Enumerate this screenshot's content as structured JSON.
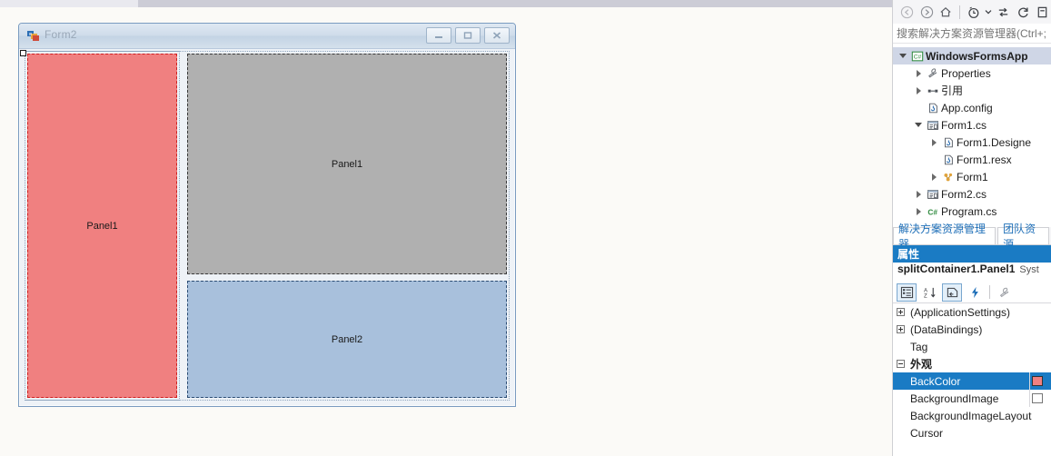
{
  "designer": {
    "form": {
      "title": "Form2",
      "icon": "windows-form-icon",
      "window_buttons": [
        {
          "name": "minimize-button",
          "glyph": "minimize-icon"
        },
        {
          "name": "maximize-button",
          "glyph": "maximize-icon"
        },
        {
          "name": "close-button",
          "glyph": "close-icon"
        }
      ],
      "panels": [
        {
          "name": "panel-left",
          "label": "Panel1",
          "color": "#f08080",
          "border_color": "#d11f1f"
        },
        {
          "name": "panel-top-right",
          "label": "Panel1",
          "color": "#b0b0b0",
          "border_color": "#3a3a3a"
        },
        {
          "name": "panel-bottom-right",
          "label": "Panel2",
          "color": "#a8c0dc",
          "border_color": "#2b4c73"
        }
      ]
    }
  },
  "solution_explorer": {
    "toolbar": [
      {
        "name": "back-button",
        "icon": "back-arrow-icon"
      },
      {
        "name": "forward-button",
        "icon": "forward-arrow-icon"
      },
      {
        "name": "home-button",
        "icon": "home-icon"
      },
      {
        "name": "pending-changes-button",
        "icon": "clock-icon"
      },
      {
        "name": "pending-changes-dropdown",
        "icon": "chevron-down-icon"
      },
      {
        "name": "sync-button",
        "icon": "sync-arrows-icon"
      },
      {
        "name": "refresh-button",
        "icon": "refresh-icon"
      },
      {
        "name": "collapse-all-button",
        "icon": "collapse-all-icon"
      }
    ],
    "search": {
      "placeholder": "搜索解决方案资源管理器(Ctrl+;",
      "value": ""
    },
    "tree": [
      {
        "label": "WindowsFormsApp",
        "icon": "csharp-project-icon",
        "indent": 0,
        "expander": "expanded",
        "bold": true,
        "selected": true
      },
      {
        "label": "Properties",
        "icon": "wrench-icon",
        "indent": 1,
        "expander": "collapsed",
        "bold": false,
        "selected": false
      },
      {
        "label": "引用",
        "icon": "references-icon",
        "indent": 1,
        "expander": "collapsed",
        "bold": false,
        "selected": false
      },
      {
        "label": "App.config",
        "icon": "config-file-icon",
        "indent": 1,
        "expander": "none",
        "bold": false,
        "selected": false
      },
      {
        "label": "Form1.cs",
        "icon": "form-file-icon",
        "indent": 1,
        "expander": "expanded",
        "bold": false,
        "selected": false
      },
      {
        "label": "Form1.Designe",
        "icon": "code-file-icon",
        "indent": 2,
        "expander": "collapsed",
        "bold": false,
        "selected": false
      },
      {
        "label": "Form1.resx",
        "icon": "code-file-icon",
        "indent": 2,
        "expander": "none",
        "bold": false,
        "selected": false
      },
      {
        "label": "Form1",
        "icon": "class-icon",
        "indent": 2,
        "expander": "collapsed",
        "bold": false,
        "selected": false
      },
      {
        "label": "Form2.cs",
        "icon": "form-file-icon",
        "indent": 1,
        "expander": "collapsed",
        "bold": false,
        "selected": false
      },
      {
        "label": "Program.cs",
        "icon": "csharp-file-icon",
        "indent": 1,
        "expander": "collapsed",
        "bold": false,
        "selected": false
      }
    ],
    "tabs": [
      {
        "label": "解决方案资源管理器",
        "active": true
      },
      {
        "label": "团队资源",
        "active": false
      }
    ]
  },
  "properties": {
    "header": "属性",
    "object_name": "splitContainer1.Panel1",
    "object_type": "Syst",
    "toolbar": [
      {
        "name": "categorized-button",
        "icon": "categorized-icon",
        "active": true
      },
      {
        "name": "alphabetical-button",
        "icon": "sort-az-icon",
        "active": false
      },
      {
        "name": "properties-button",
        "icon": "properties-page-icon",
        "active": true
      },
      {
        "name": "events-button",
        "icon": "lightning-bolt-icon",
        "active": false
      },
      {
        "name": "property-pages-button",
        "icon": "wrench-icon",
        "active": false
      }
    ],
    "rows": [
      {
        "name": "(ApplicationSettings)",
        "expander": "plus",
        "category": false,
        "selected": false,
        "value_kind": "none"
      },
      {
        "name": "(DataBindings)",
        "expander": "plus",
        "category": false,
        "selected": false,
        "value_kind": "none"
      },
      {
        "name": "Tag",
        "expander": "none",
        "category": false,
        "selected": false,
        "value_kind": "none"
      },
      {
        "name": "外观",
        "expander": "minus",
        "category": true,
        "selected": false,
        "value_kind": "none"
      },
      {
        "name": "BackColor",
        "expander": "none",
        "category": false,
        "selected": true,
        "value_kind": "swatch",
        "value_color": "#f08080"
      },
      {
        "name": "BackgroundImage",
        "expander": "none",
        "category": false,
        "selected": false,
        "value_kind": "box"
      },
      {
        "name": "BackgroundImageLayout",
        "expander": "none",
        "category": false,
        "selected": false,
        "value_kind": "none"
      },
      {
        "name": "Cursor",
        "expander": "none",
        "category": false,
        "selected": false,
        "value_kind": "none"
      }
    ]
  }
}
